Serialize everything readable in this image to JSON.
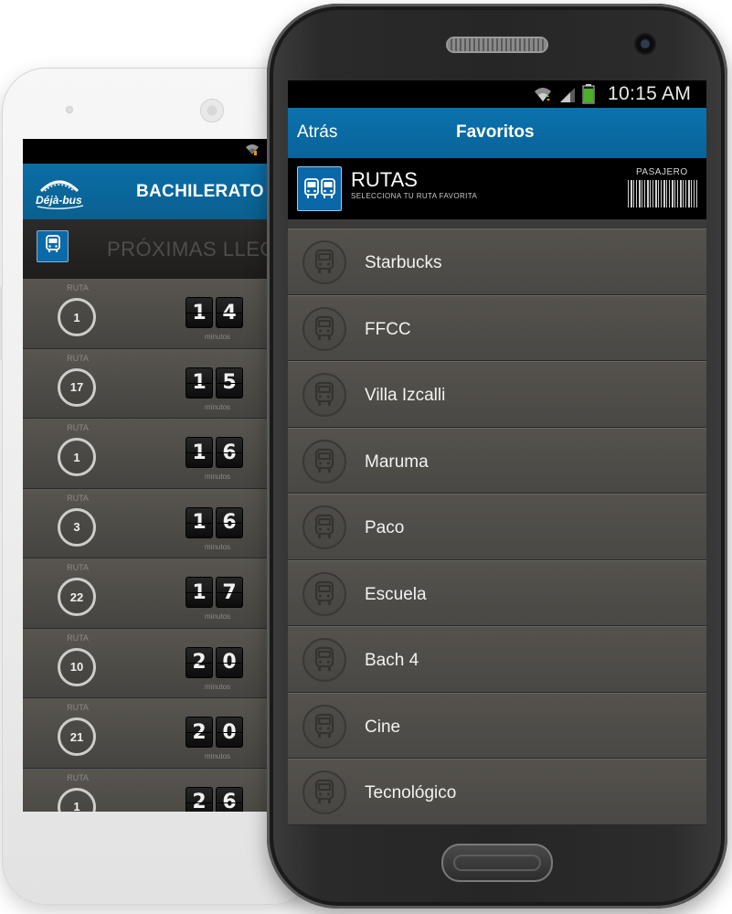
{
  "back_phone": {
    "header_title": "BACHILERATO",
    "logo_text": "Déjà-bus",
    "subheader_text": "PRÓXIMAS LLEGA",
    "route_label": "RUTA",
    "minutes_label": "minutos",
    "rows": [
      {
        "route": "1",
        "digits": [
          "1",
          "4"
        ]
      },
      {
        "route": "17",
        "digits": [
          "1",
          "5"
        ]
      },
      {
        "route": "1",
        "digits": [
          "1",
          "6"
        ]
      },
      {
        "route": "3",
        "digits": [
          "1",
          "6"
        ]
      },
      {
        "route": "22",
        "digits": [
          "1",
          "7"
        ]
      },
      {
        "route": "10",
        "digits": [
          "2",
          "0"
        ]
      },
      {
        "route": "21",
        "digits": [
          "2",
          "0"
        ]
      },
      {
        "route": "1",
        "digits": [
          "2",
          "6"
        ]
      }
    ]
  },
  "front_phone": {
    "status_time": "10:15 AM",
    "header": {
      "back_label": "Atrás",
      "title": "Favoritos"
    },
    "subheader": {
      "title": "RUTAS",
      "subtitle": "SELECCIONA TU RUTA FAVORITA",
      "ticket_label": "PASAJERO"
    },
    "favorites": [
      {
        "label": "Starbucks"
      },
      {
        "label": "FFCC"
      },
      {
        "label": "Villa Izcalli"
      },
      {
        "label": "Maruma"
      },
      {
        "label": "Paco"
      },
      {
        "label": "Escuela"
      },
      {
        "label": "Bach 4"
      },
      {
        "label": "Cine"
      },
      {
        "label": "Tecnológico"
      }
    ]
  },
  "colors": {
    "brand_blue": "#0b72ad",
    "list_row_bg": "#4e4b47",
    "battery_green": "#4caf2a"
  }
}
